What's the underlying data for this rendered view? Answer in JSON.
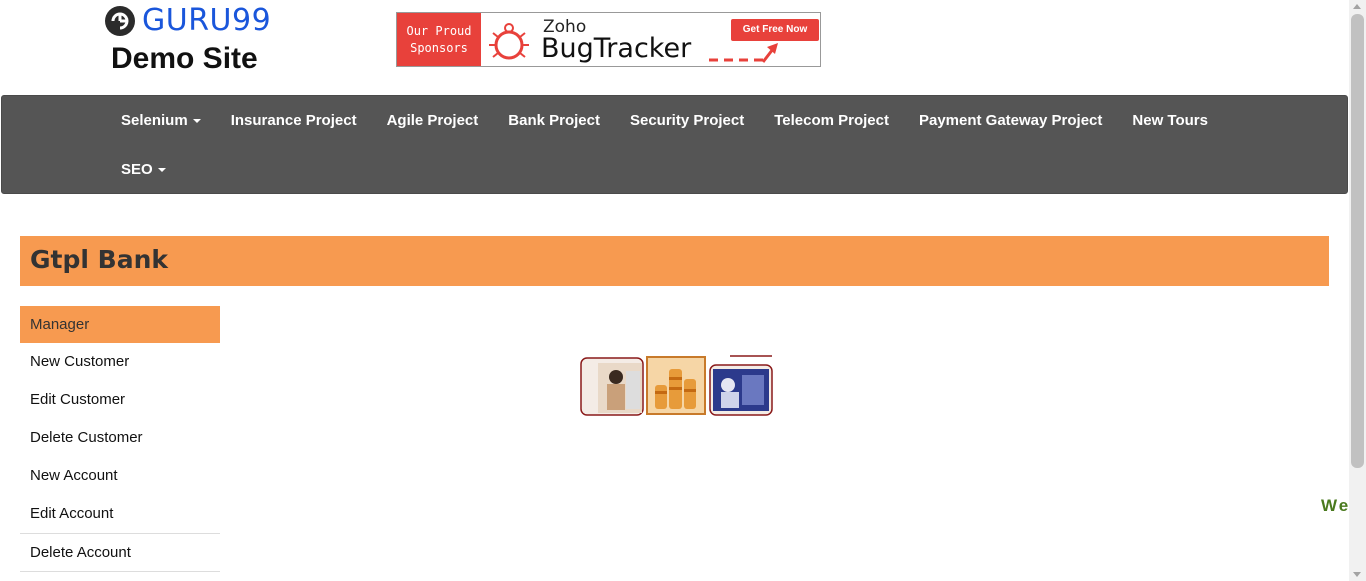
{
  "logo": {
    "brand": "GURU99",
    "subtitle": "Demo Site",
    "icon": "guru99-logo-icon"
  },
  "banner": {
    "left_text_line1": "Our Proud",
    "left_text_line2": "Sponsors",
    "brand_small": "Zoho",
    "brand_large": "BugTracker",
    "cta": "Get Free Now"
  },
  "nav": {
    "items": [
      {
        "label": "Selenium",
        "dropdown": true
      },
      {
        "label": "Insurance Project",
        "dropdown": false
      },
      {
        "label": "Agile Project",
        "dropdown": false
      },
      {
        "label": "Bank Project",
        "dropdown": false
      },
      {
        "label": "Security Project",
        "dropdown": false
      },
      {
        "label": "Telecom Project",
        "dropdown": false
      },
      {
        "label": "Payment Gateway Project",
        "dropdown": false
      },
      {
        "label": "New Tours",
        "dropdown": false
      },
      {
        "label": "SEO",
        "dropdown": true
      }
    ]
  },
  "bank": {
    "title": "Gtpl Bank"
  },
  "menu": {
    "items": [
      {
        "label": "Manager",
        "active": true
      },
      {
        "label": "New Customer"
      },
      {
        "label": "Edit Customer"
      },
      {
        "label": "Delete Customer"
      },
      {
        "label": "New Account"
      },
      {
        "label": "Edit Account"
      },
      {
        "label": "Delete Account"
      }
    ]
  },
  "marquee": {
    "text": "We"
  },
  "colors": {
    "accent": "#f79a50",
    "navbar": "#555555",
    "logo_blue": "#1a56db",
    "banner_red": "#e8413b",
    "marquee_green": "#4a7a1e"
  }
}
